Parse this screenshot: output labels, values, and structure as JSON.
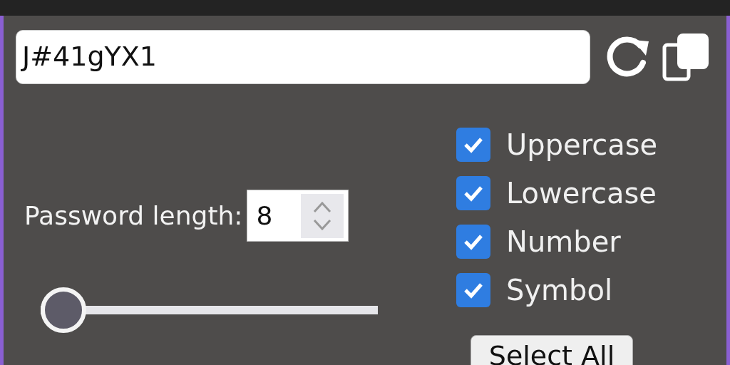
{
  "password": {
    "value": "J#41gYX1"
  },
  "length": {
    "label": "Password length:",
    "value": "8",
    "level": 0
  },
  "options": [
    {
      "label": "Uppercase",
      "checked": true
    },
    {
      "label": "Lowercase",
      "checked": true
    },
    {
      "label": "Number",
      "checked": true
    },
    {
      "label": "Symbol",
      "checked": true
    }
  ],
  "select_all": {
    "label": "Select All"
  }
}
